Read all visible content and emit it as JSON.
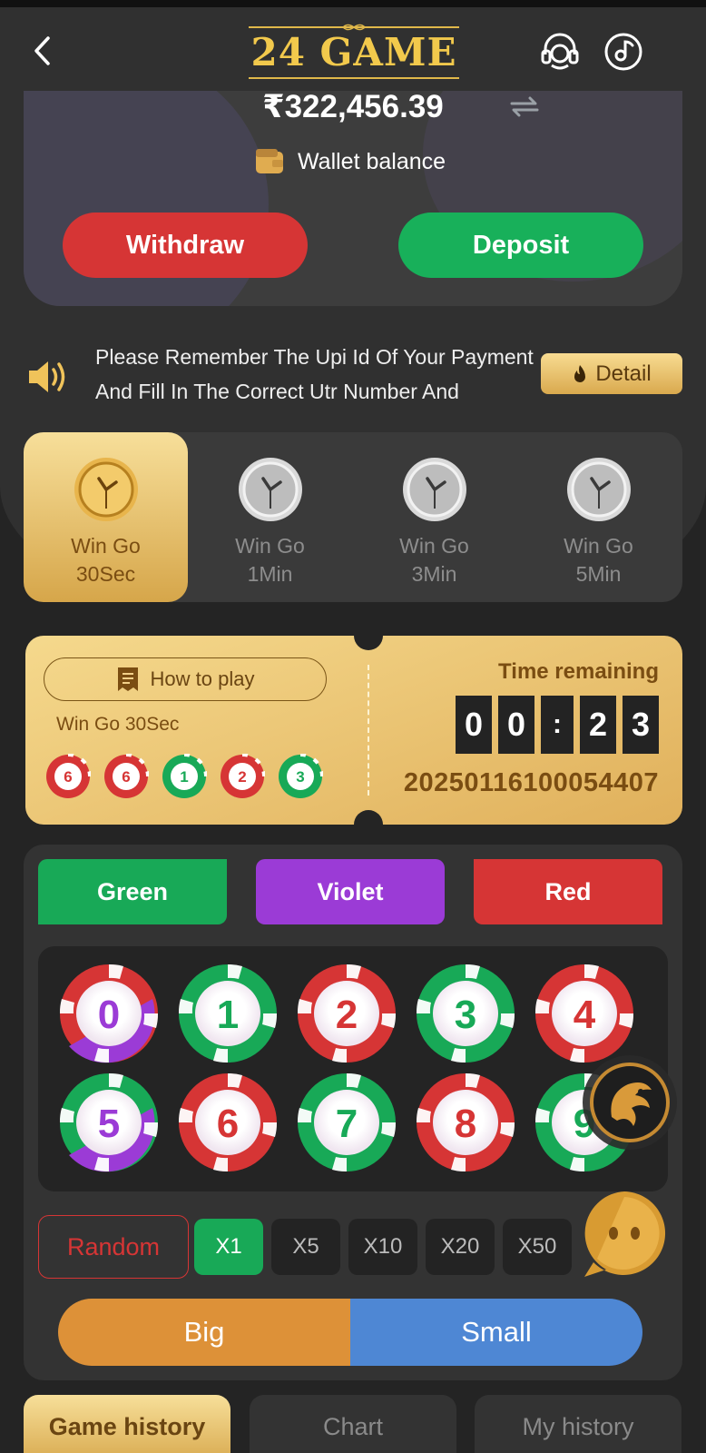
{
  "header": {
    "logo_text": "24 GAME"
  },
  "wallet": {
    "balance": "₹322,456.39",
    "label": "Wallet balance",
    "withdraw_label": "Withdraw",
    "deposit_label": "Deposit"
  },
  "notice": {
    "text": "Please Remember The Upi Id Of Your Payment And Fill In The Correct Utr Number And",
    "detail_label": "Detail"
  },
  "game_tabs": [
    {
      "line1": "Win Go",
      "line2": "30Sec",
      "active": true
    },
    {
      "line1": "Win Go",
      "line2": "1Min",
      "active": false
    },
    {
      "line1": "Win Go",
      "line2": "3Min",
      "active": false
    },
    {
      "line1": "Win Go",
      "line2": "5Min",
      "active": false
    }
  ],
  "ticket": {
    "how_to_play": "How to play",
    "current_game": "Win Go 30Sec",
    "recent_results": [
      "6",
      "6",
      "1",
      "2",
      "3"
    ],
    "time_label": "Time remaining",
    "timer_digits": [
      "0",
      "0",
      ":",
      "2",
      "3"
    ],
    "period": "20250116100054407"
  },
  "colors": {
    "green_label": "Green",
    "violet_label": "Violet",
    "red_label": "Red",
    "green": "#18a957",
    "violet": "#9b3bd6",
    "red": "#d63535",
    "gold": "#e0b05b"
  },
  "numbers": [
    "0",
    "1",
    "2",
    "3",
    "4",
    "5",
    "6",
    "7",
    "8",
    "9"
  ],
  "bet": {
    "random_label": "Random",
    "multipliers": [
      "X1",
      "X5",
      "X10",
      "X20",
      "X50"
    ],
    "active_multiplier": "X1",
    "big_label": "Big",
    "small_label": "Small"
  },
  "history_tabs": [
    "Game history",
    "Chart",
    "My history"
  ],
  "icons": {
    "back": "chevron-left-icon",
    "support": "headset-icon",
    "music": "music-disc-icon",
    "refresh": "refresh-icon",
    "wallet": "wallet-icon",
    "speaker": "speaker-icon",
    "detail": "flame-icon",
    "how_to_play": "document-icon",
    "clock": "clock-icon",
    "float_dragon": "dragon-icon",
    "float_chat": "chat-bubble-icon"
  }
}
